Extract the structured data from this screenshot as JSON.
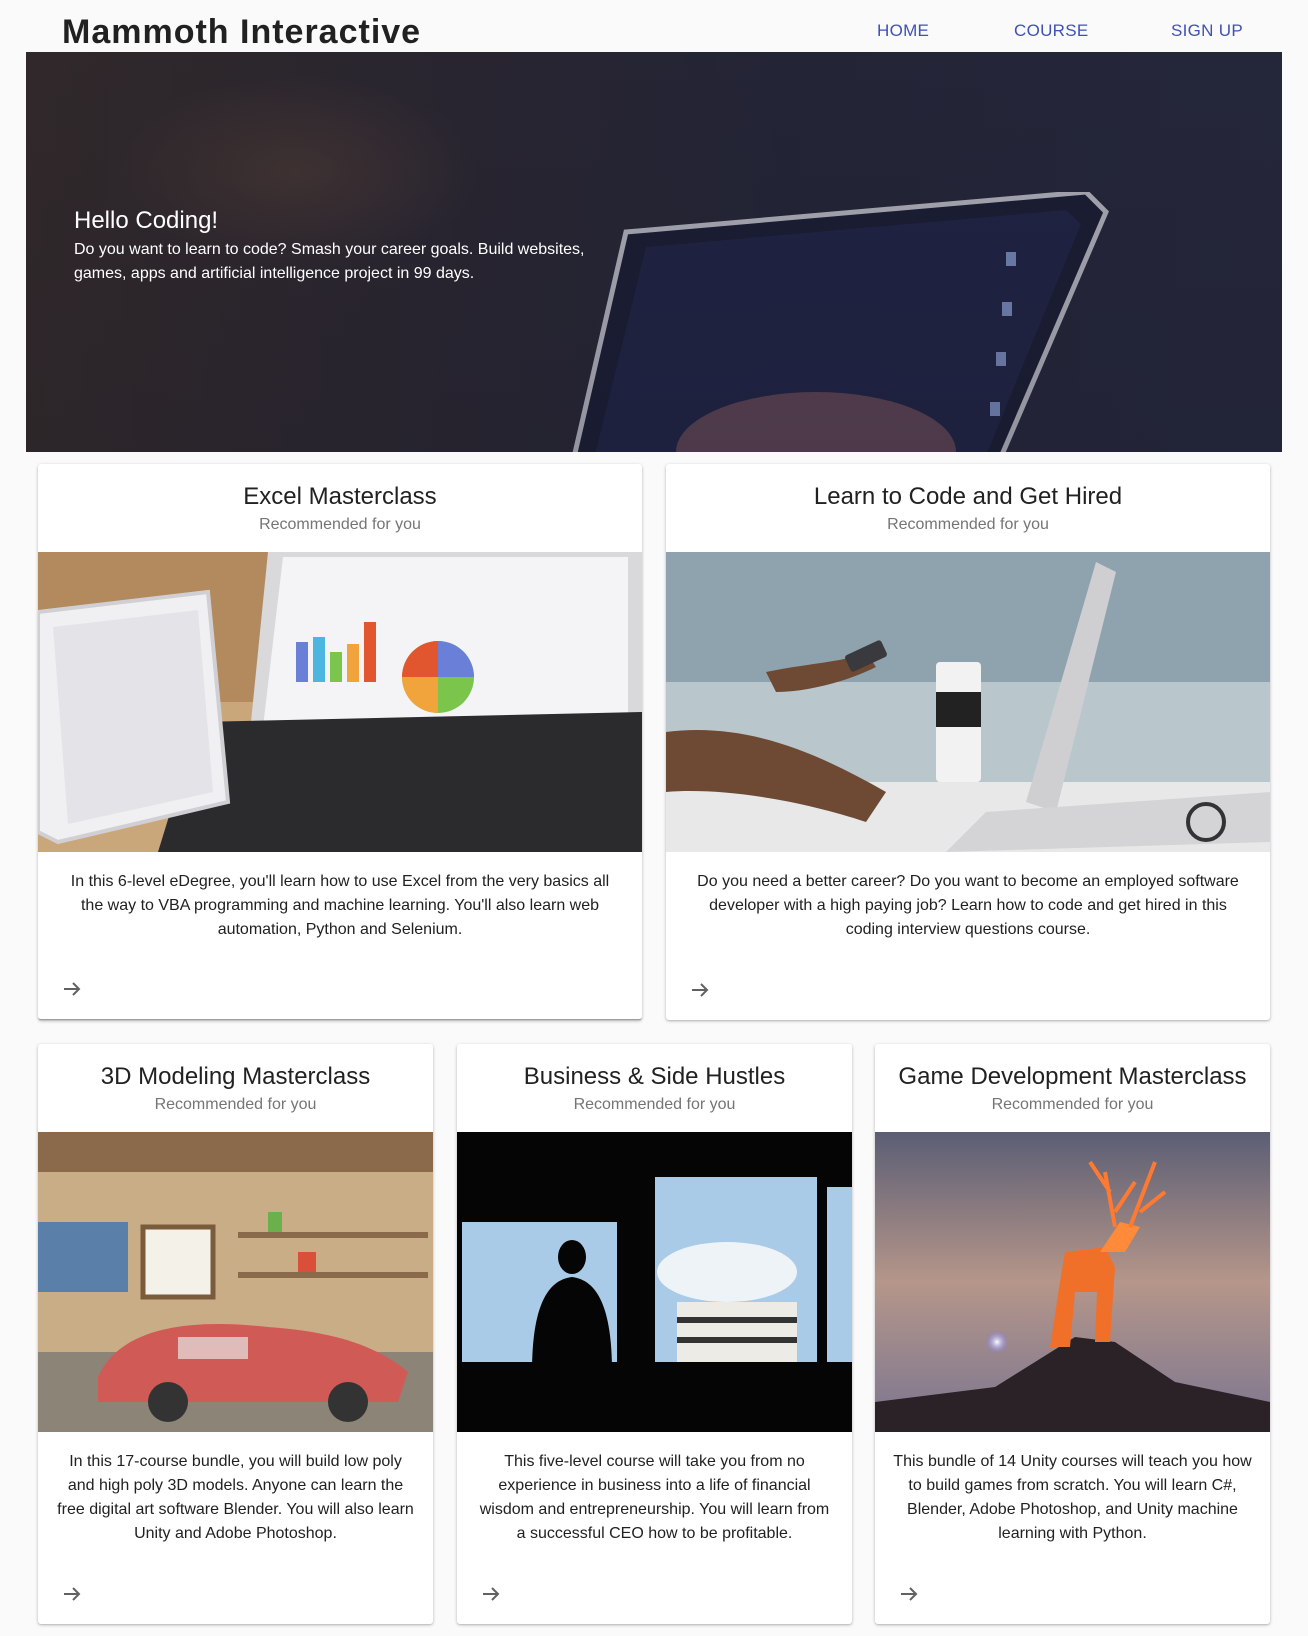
{
  "brand": "Mammoth Interactive",
  "nav": {
    "home": "HOME",
    "course": "COURSE",
    "signup": "SIGN UP"
  },
  "hero": {
    "title": "Hello Coding!",
    "text": "Do you want to learn to code? Smash your career goals. Build websites, games, apps and artificial intelligence project in 99 days."
  },
  "cards": [
    {
      "title": "Excel Masterclass",
      "subtitle": "Recommended for you",
      "image": "laptop-with-charts-and-tablet",
      "description": "In this 6-level eDegree, you'll learn how to use Excel from the very basics all the way to VBA programming and machine learning. You'll also learn web automation, Python and Selenium.",
      "arrow_icon": "arrow-forward-icon"
    },
    {
      "title": "Learn to Code and Get Hired",
      "subtitle": "Recommended for you",
      "image": "person-typing-on-laptop-holding-phone",
      "description": "Do you need a better career? Do you want to become an employed software developer with a high paying job? Learn how to code and get hired in this coding interview questions course.",
      "arrow_icon": "arrow-forward-icon"
    },
    {
      "title": "3D Modeling Masterclass",
      "subtitle": "Recommended for you",
      "image": "3d-garage-with-red-car",
      "description": "In this 17-course bundle, you will build low poly and high poly 3D models. Anyone can learn the free digital art software Blender. You will also learn Unity and Adobe Photoshop.",
      "arrow_icon": "arrow-forward-icon"
    },
    {
      "title": "Business & Side Hustles",
      "subtitle": "Recommended for you",
      "image": "silhouette-at-office-window",
      "description": "This five-level course will take you from no experience in business into a life of financial wisdom and entrepreneurship. You will learn from a successful CEO how to be profitable.",
      "arrow_icon": "arrow-forward-icon"
    },
    {
      "title": "Game Development Masterclass",
      "subtitle": "Recommended for you",
      "image": "low-poly-glowing-deer-on-mountain",
      "description": "This bundle of 14 Unity courses will teach you how to build games from scratch. You will learn C#, Blender, Adobe Photoshop, and Unity machine learning with Python.",
      "arrow_icon": "arrow-forward-icon"
    }
  ],
  "colors": {
    "nav_link": "#3f51b5",
    "background": "#fafafa",
    "card": "#ffffff",
    "subtitle": "#757575"
  }
}
